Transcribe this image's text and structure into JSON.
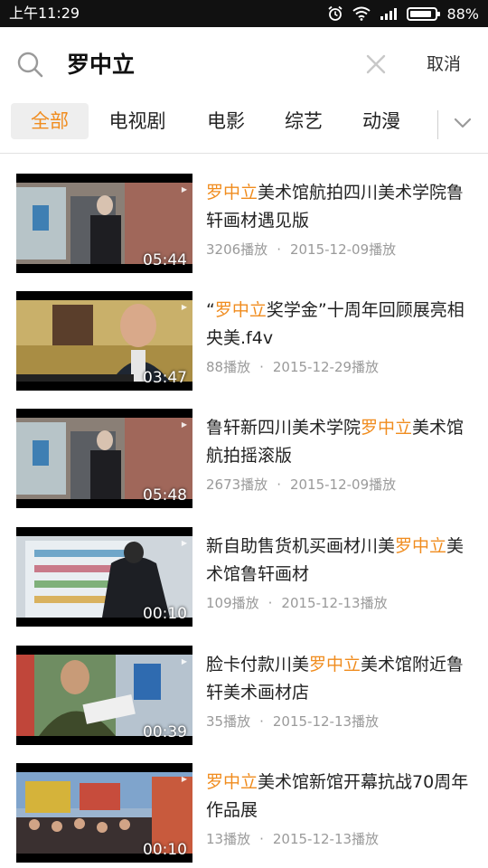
{
  "status_bar": {
    "time": "上午11:29",
    "battery": "88%",
    "battery_level": 0.88
  },
  "search": {
    "query": "罗中立",
    "cancel_label": "取消"
  },
  "tabs": [
    {
      "label": "全部"
    },
    {
      "label": "电视剧"
    },
    {
      "label": "电影"
    },
    {
      "label": "综艺"
    },
    {
      "label": "动漫"
    }
  ],
  "colors": {
    "accent": "#f08c1e",
    "meta": "#9a9a9a"
  },
  "results": [
    {
      "title_parts": [
        {
          "t": "罗中立",
          "hl": true
        },
        {
          "t": "美术馆航拍四川美术学院鲁轩画材遇见版",
          "hl": false
        }
      ],
      "duration": "05:44",
      "plays": "3206播放",
      "date": "2015-12-09播放"
    },
    {
      "title_parts": [
        {
          "t": "“",
          "hl": false
        },
        {
          "t": "罗中立",
          "hl": true
        },
        {
          "t": "奖学金”十周年回顾展亮相央美.f4v",
          "hl": false
        }
      ],
      "duration": "03:47",
      "plays": "88播放",
      "date": "2015-12-29播放"
    },
    {
      "title_parts": [
        {
          "t": "鲁轩新四川美术学院",
          "hl": false
        },
        {
          "t": "罗中立",
          "hl": true
        },
        {
          "t": "美术馆航拍摇滚版",
          "hl": false
        }
      ],
      "duration": "05:48",
      "plays": "2673播放",
      "date": "2015-12-09播放"
    },
    {
      "title_parts": [
        {
          "t": "新自助售货机买画材川美",
          "hl": false
        },
        {
          "t": "罗中立",
          "hl": true
        },
        {
          "t": "美术馆鲁轩画材",
          "hl": false
        }
      ],
      "duration": "00:10",
      "plays": "109播放",
      "date": "2015-12-13播放"
    },
    {
      "title_parts": [
        {
          "t": "脸卡付款川美",
          "hl": false
        },
        {
          "t": "罗中立",
          "hl": true
        },
        {
          "t": "美术馆附近鲁轩美术画材店",
          "hl": false
        }
      ],
      "duration": "00:39",
      "plays": "35播放",
      "date": "2015-12-13播放"
    },
    {
      "title_parts": [
        {
          "t": "罗中立",
          "hl": true
        },
        {
          "t": "美术馆新馆开幕抗战70周年作品展",
          "hl": false
        }
      ],
      "duration": "00:10",
      "plays": "13播放",
      "date": "2015-12-13播放"
    }
  ]
}
